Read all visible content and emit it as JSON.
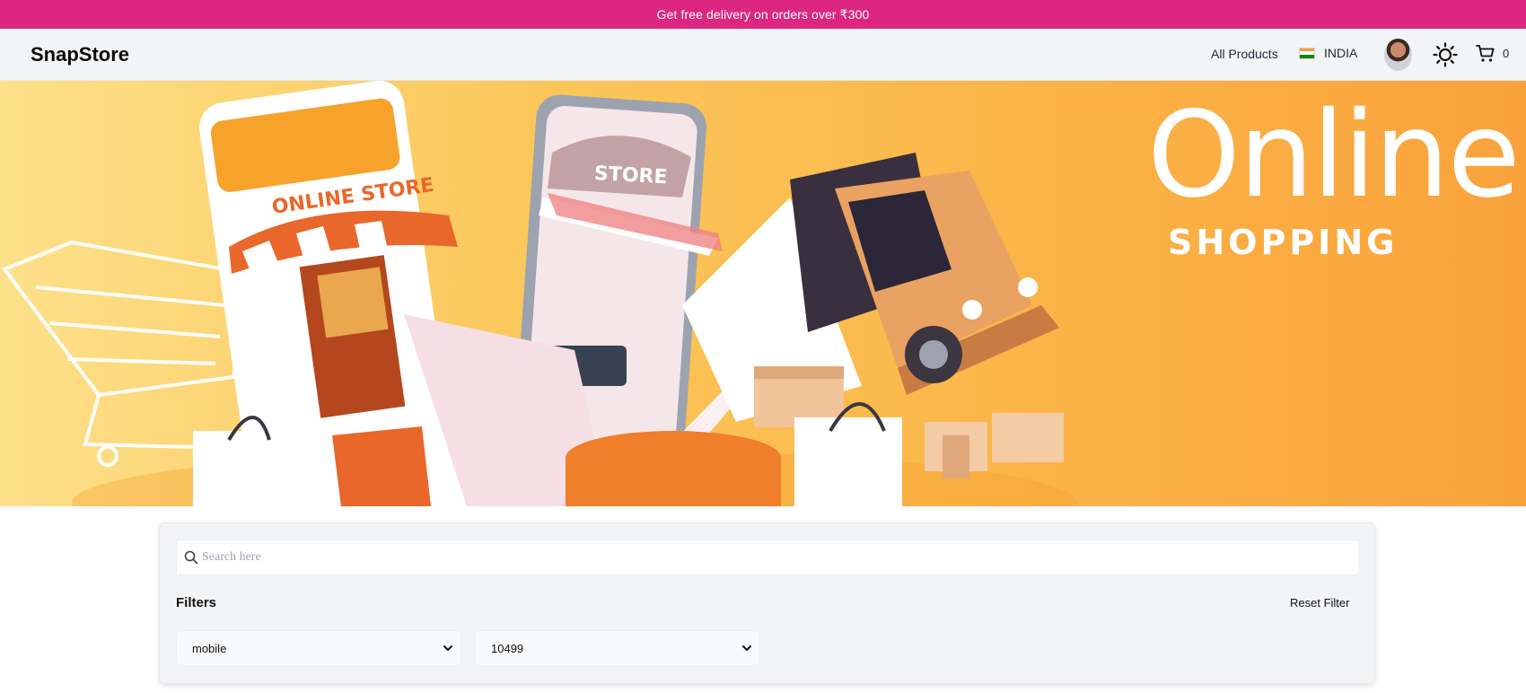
{
  "promo": {
    "text": "Get free delivery on orders over ₹300"
  },
  "header": {
    "brand": "SnapStore",
    "nav_link": "All Products",
    "country": "INDIA",
    "cart_count": "0"
  },
  "hero": {
    "headline": "Online.",
    "subheadline": "SHOPPING",
    "sign_store": "ONLINE STORE",
    "sign_phone": "STORE"
  },
  "search": {
    "placeholder": "Search here",
    "value": ""
  },
  "filters": {
    "title": "Filters",
    "reset_label": "Reset Filter",
    "category": {
      "selected": "mobile"
    },
    "price": {
      "selected": "10499"
    }
  },
  "colors": {
    "promo_bg": "#dc267f",
    "nav_bg": "#f3f4f6",
    "hero_bg": "#fbb347",
    "panel_bg": "#f3f4f6"
  },
  "icons": [
    "search-icon",
    "flag-india-icon",
    "avatar",
    "sun-icon",
    "cart-icon",
    "chevron-down-icon"
  ]
}
